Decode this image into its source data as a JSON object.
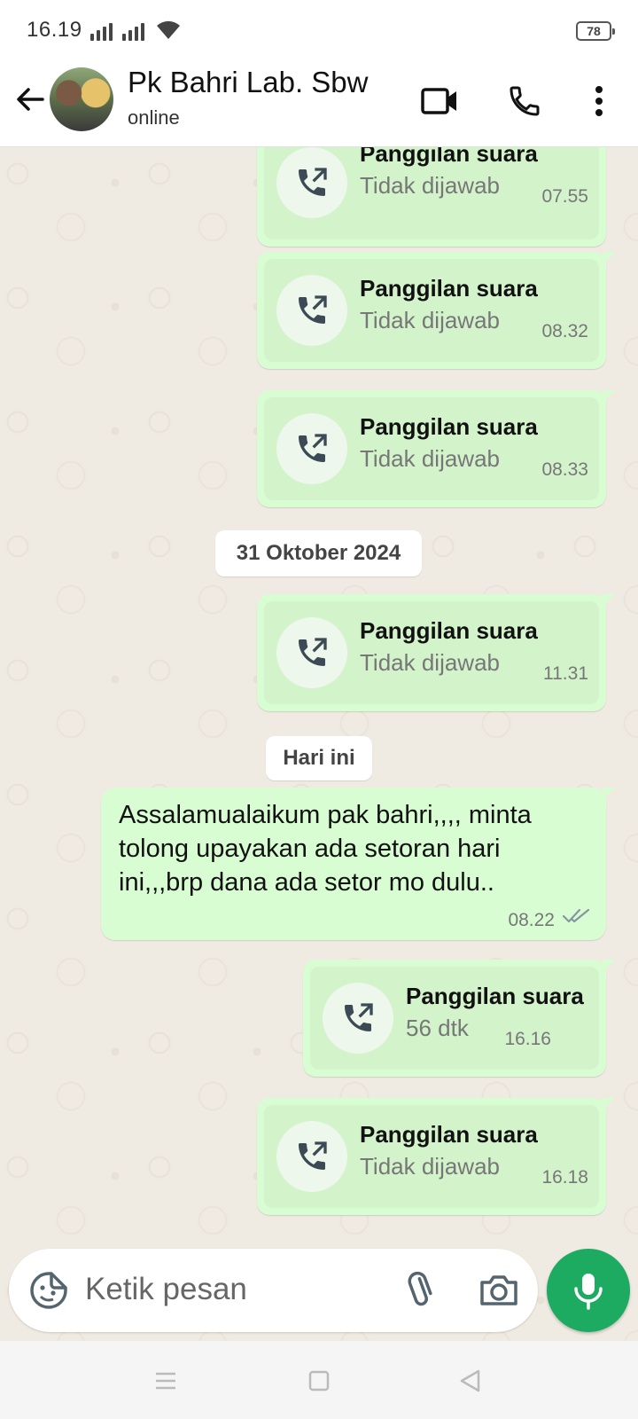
{
  "status_bar": {
    "time": "16.19",
    "battery": "78"
  },
  "header": {
    "contact_name": "Pk Bahri Lab. Sbw",
    "contact_status": "online"
  },
  "chat": {
    "messages": [
      {
        "type": "call",
        "title": "Panggilan suara",
        "subtitle": "Tidak dijawab",
        "time": "07.55"
      },
      {
        "type": "call",
        "title": "Panggilan suara",
        "subtitle": "Tidak dijawab",
        "time": "08.32"
      },
      {
        "type": "call",
        "title": "Panggilan suara",
        "subtitle": "Tidak dijawab",
        "time": "08.33"
      },
      {
        "type": "date",
        "label": "31 Oktober 2024"
      },
      {
        "type": "call",
        "title": "Panggilan suara",
        "subtitle": "Tidak dijawab",
        "time": "11.31"
      },
      {
        "type": "date",
        "label": "Hari ini"
      },
      {
        "type": "text",
        "text": "Assalamualaikum pak bahri,,,, minta tolong upayakan ada setoran hari ini,,,brp dana ada setor mo dulu..",
        "time": "08.22",
        "status": "double-check-icon"
      },
      {
        "type": "call",
        "title": "Panggilan suara",
        "subtitle": "56 dtk",
        "time": "16.16"
      },
      {
        "type": "call",
        "title": "Panggilan suara",
        "subtitle": "Tidak dijawab",
        "time": "16.18"
      }
    ]
  },
  "input": {
    "placeholder": "Ketik pesan"
  },
  "colors": {
    "bubble_out": "#d9fdd3",
    "accent": "#1daa61",
    "chat_bg": "#efeae2"
  },
  "icons": [
    "back-arrow-icon",
    "video-call-icon",
    "voice-call-icon",
    "more-vert-icon",
    "outgoing-call-icon",
    "sticker-icon",
    "attach-icon",
    "camera-icon",
    "mic-icon"
  ]
}
